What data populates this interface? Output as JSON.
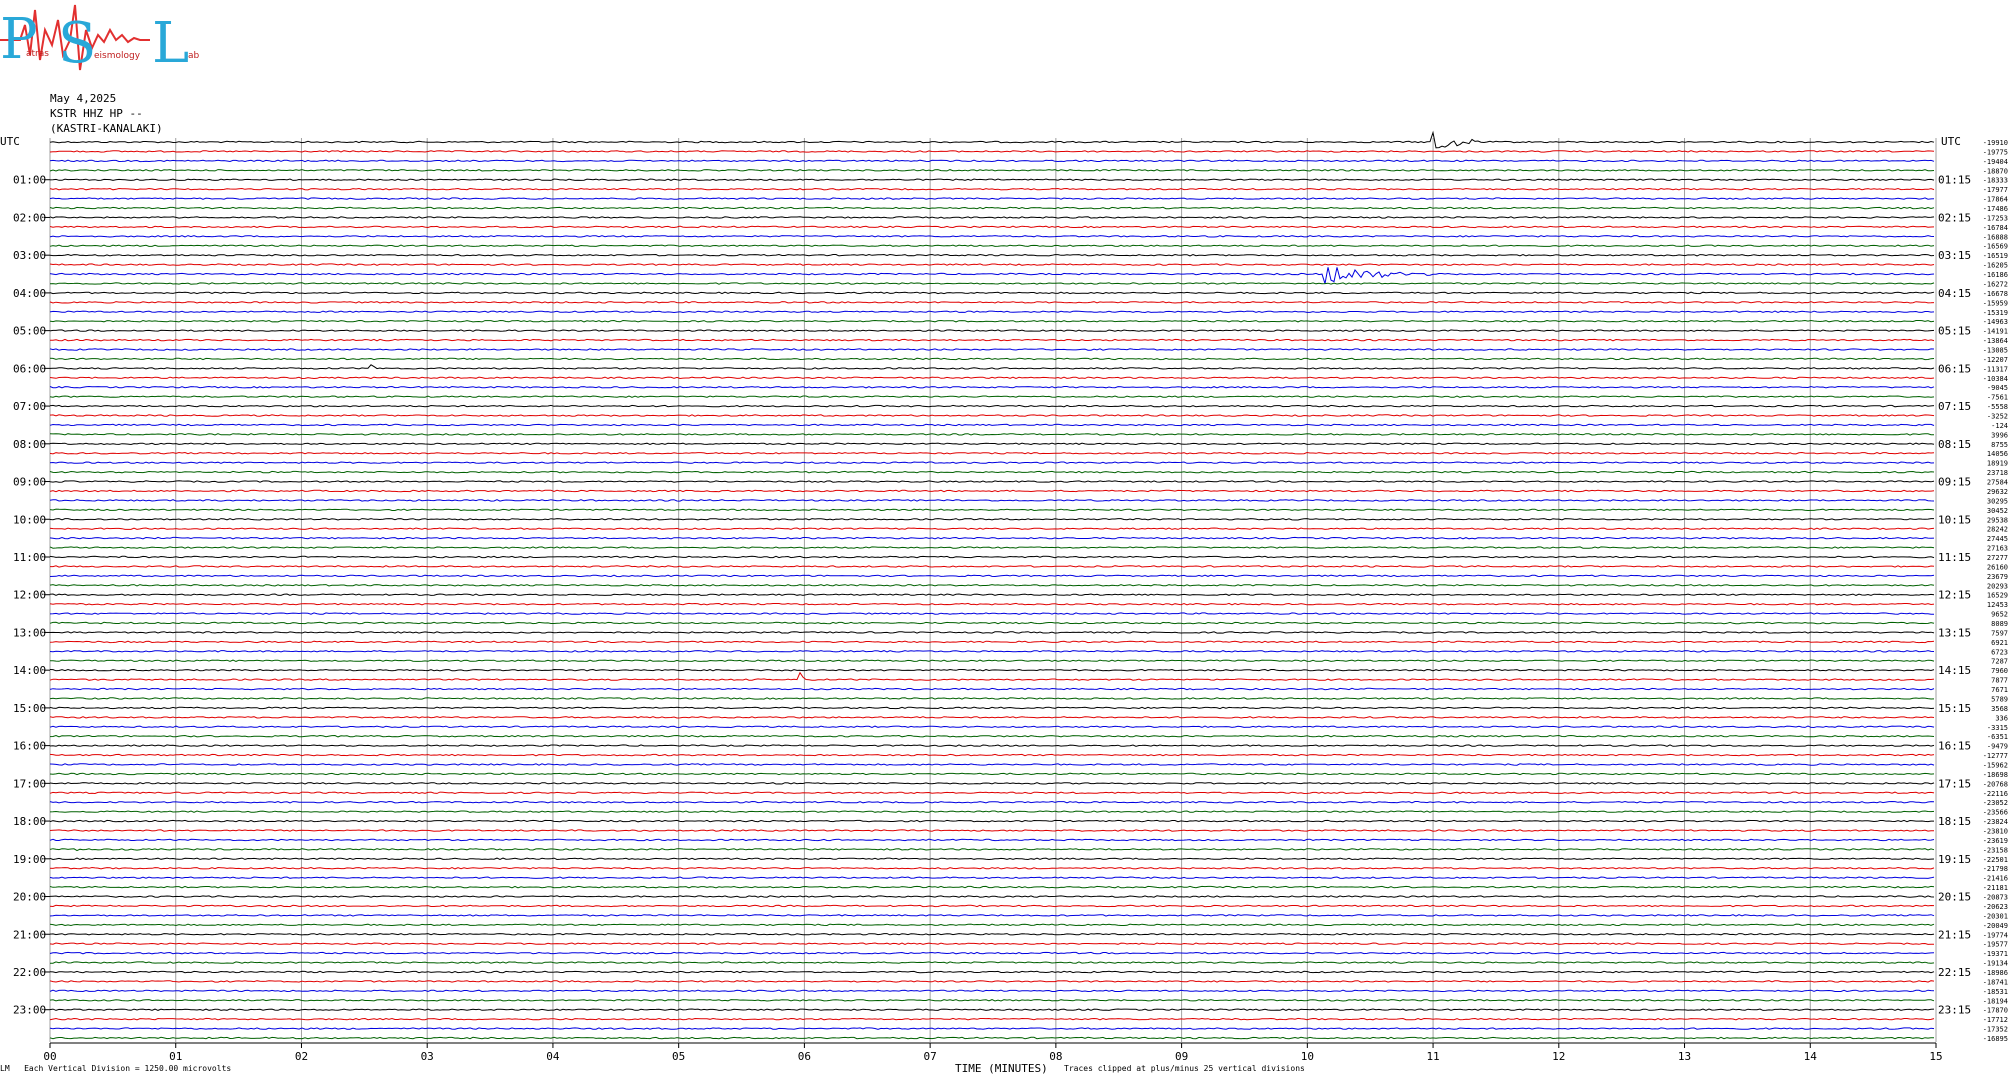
{
  "logo": {
    "big_letters": [
      "P",
      "S",
      "L"
    ],
    "small_words": [
      "atras",
      "eismology",
      "ab"
    ]
  },
  "header": {
    "date": "May 4,2025",
    "station": "KSTR HHZ HP --",
    "location": "(KASTRI-KANALAKI)"
  },
  "colors": {
    "trace_cycle": [
      "#000000",
      "#e00000",
      "#0000e0",
      "#006000"
    ],
    "grid": "#a0a0a0",
    "logo_red": "#e23030",
    "logo_cyan": "#29a8d8"
  },
  "footer": {
    "scale_note": "Each Vertical Division = 1250.00 microvolts",
    "xlabel": "TIME (MINUTES)",
    "clip_note": "Traces clipped at plus/minus 25 vertical divisions",
    "corner_mark": "LM"
  },
  "chart_data": {
    "type": "line",
    "title": "",
    "xlabel": "TIME (MINUTES)",
    "ylabel": "",
    "x_ticks": [
      "00",
      "01",
      "02",
      "03",
      "04",
      "05",
      "06",
      "07",
      "08",
      "09",
      "10",
      "11",
      "12",
      "13",
      "14",
      "15"
    ],
    "xlim": [
      0,
      15
    ],
    "left_axis_title": "UTC",
    "right_axis_title": "UTC",
    "left_time_labels": [
      "01:00",
      "02:00",
      "03:00",
      "04:00",
      "05:00",
      "06:00",
      "07:00",
      "08:00",
      "09:00",
      "10:00",
      "11:00",
      "12:00",
      "13:00",
      "14:00",
      "15:00",
      "16:00",
      "17:00",
      "18:00",
      "19:00",
      "20:00",
      "21:00",
      "22:00",
      "23:00"
    ],
    "right_time_labels": [
      "01:15",
      "02:15",
      "03:15",
      "04:15",
      "05:15",
      "06:15",
      "07:15",
      "08:15",
      "09:15",
      "10:15",
      "11:15",
      "12:15",
      "13:15",
      "14:15",
      "15:15",
      "16:15",
      "17:15",
      "18:15",
      "19:15",
      "20:15",
      "21:15",
      "22:15",
      "23:15"
    ],
    "trace_minutes_each": 15,
    "trace_count": 96,
    "trace_offsets": [
      "-19910",
      "-19775",
      "-19404",
      "-18870",
      "-18333",
      "-17977",
      "-17864",
      "-17486",
      "-17253",
      "-16784",
      "-16888",
      "-16569",
      "-16519",
      "-16205",
      "-16186",
      "-16272",
      "-16678",
      "-15959",
      "-15319",
      "-14963",
      "-14191",
      "-13864",
      "-13085",
      "-12207",
      "-11317",
      "-10384",
      "-9045",
      "-7561",
      "-5558",
      "-3252",
      "-124",
      "3996",
      "8755",
      "14056",
      "18919",
      "23718",
      "27584",
      "29632",
      "30295",
      "30452",
      "29538",
      "28242",
      "27445",
      "27163",
      "27277",
      "26160",
      "23679",
      "20293",
      "16529",
      "12453",
      "9652",
      "8089",
      "7597",
      "6921",
      "6723",
      "7287",
      "7960",
      "7877",
      "7671",
      "5789",
      "3568",
      "336",
      "-3315",
      "-6351",
      "-9479",
      "-12777",
      "-15962",
      "-18698",
      "-20768",
      "-22116",
      "-23052",
      "-23566",
      "-23824",
      "-23810",
      "-23619",
      "-23158",
      "-22501",
      "-21798",
      "-21416",
      "-21181",
      "-20873",
      "-20623",
      "-20301",
      "-20049",
      "-19774",
      "-19577",
      "-19371",
      "-19134",
      "-18986",
      "-18741",
      "-18531",
      "-18194",
      "-17870",
      "-17712",
      "-17352",
      "-16895"
    ],
    "events": [
      {
        "trace": 0,
        "start_min": 10.98,
        "end_min": 11.45,
        "amplitude": 18
      },
      {
        "trace": 14,
        "start_min": 10.12,
        "end_min": 11.2,
        "amplitude": 12
      },
      {
        "trace": 24,
        "start_min": 2.55,
        "end_min": 2.65,
        "amplitude": 5
      },
      {
        "trace": 57,
        "start_min": 5.95,
        "end_min": 6.05,
        "amplitude": 14
      },
      {
        "trace": 75,
        "start_min": 0.2,
        "end_min": 0.28,
        "amplitude": 5
      }
    ],
    "grid": true,
    "vertical_division_microvolts": 1250.0,
    "clip_divisions": 25
  }
}
